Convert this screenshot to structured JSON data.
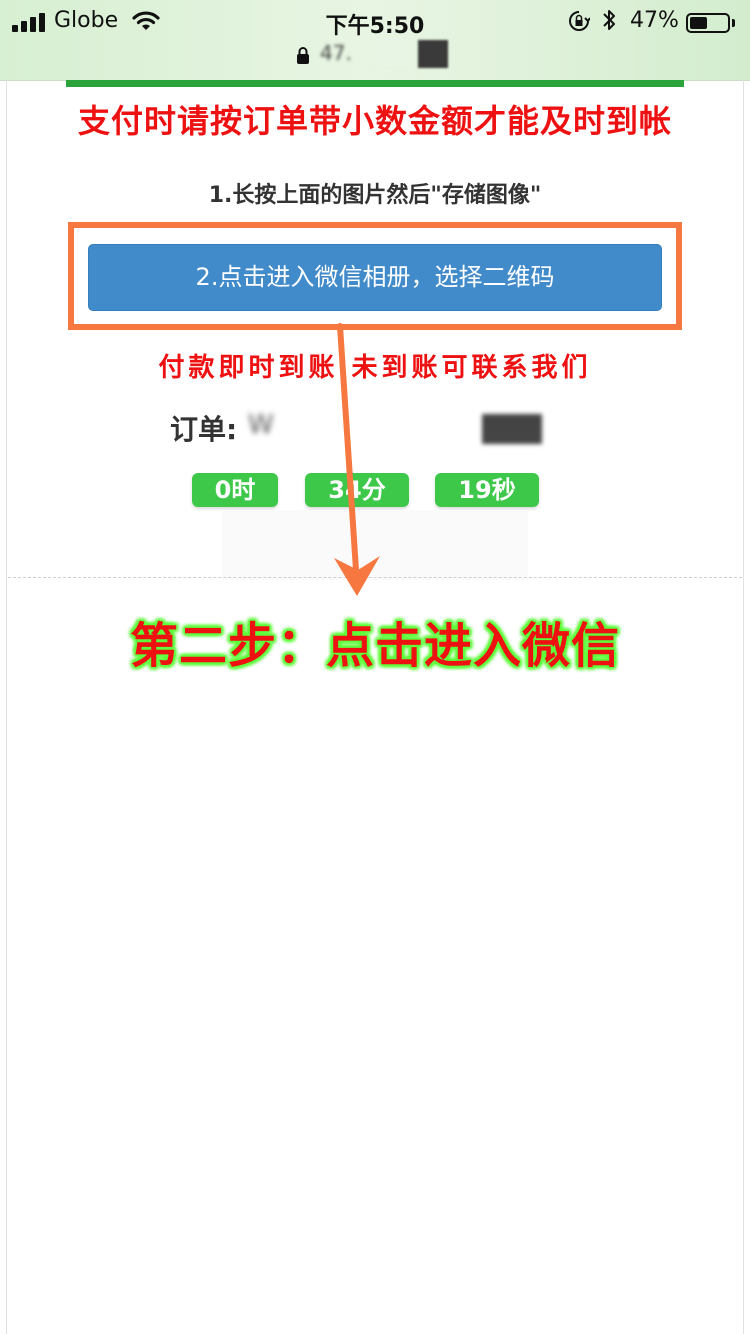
{
  "status_bar": {
    "carrier": "Globe",
    "time": "下午5:50",
    "battery": "47%",
    "battery_level": 0.47
  },
  "browser": {
    "url": "47."
  },
  "page": {
    "headline": "支付时请按订单带小数金额才能及时到帐",
    "step1_text": "1.长按上面的图片然后\"存储图像\"",
    "wechat_button_label": "2.点击进入微信相册，选择二维码",
    "arrival_note": "付款即时到账 未到账可联系我们",
    "order_label": "订单:",
    "order_value": "W",
    "timer": {
      "hours": "0时",
      "minutes": "34分",
      "seconds": "19秒"
    },
    "overlay_instruction": "第二步：点击进入微信"
  },
  "colors": {
    "accent_red": "#ee1111",
    "button_blue": "#428bca",
    "timer_green": "#3ec84a",
    "highlight_orange": "#f77740",
    "glow_green": "#5dff3a"
  }
}
